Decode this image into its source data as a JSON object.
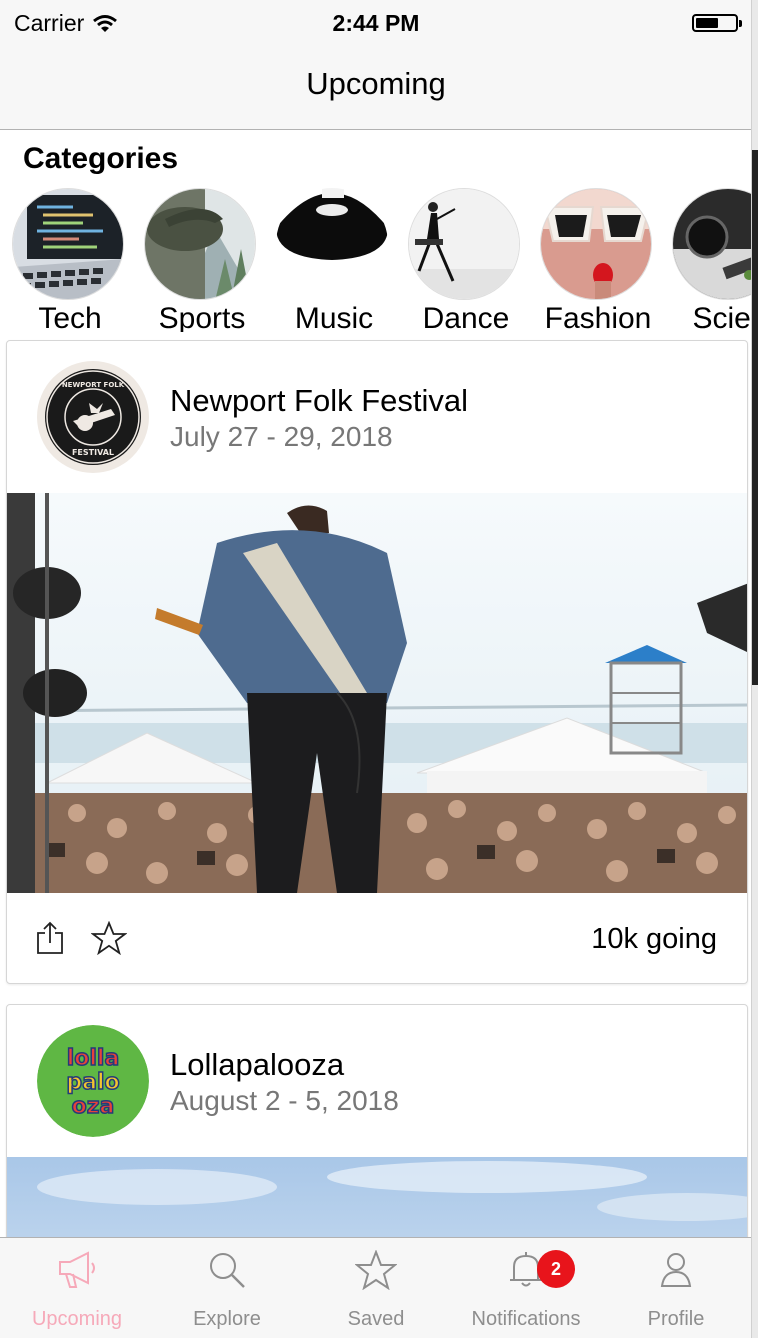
{
  "status_bar": {
    "carrier": "Carrier",
    "time": "2:44 PM"
  },
  "nav": {
    "title": "Upcoming"
  },
  "categories": {
    "heading": "Categories",
    "items": [
      {
        "label": "Tech"
      },
      {
        "label": "Sports"
      },
      {
        "label": "Music"
      },
      {
        "label": "Dance"
      },
      {
        "label": "Fashion"
      },
      {
        "label": "Scien"
      }
    ]
  },
  "events": [
    {
      "title": "Newport Folk Festival",
      "date": "July 27 - 29, 2018",
      "going": "10k going",
      "logo_text": "NEWPORT FOLK FESTIVAL"
    },
    {
      "title": "Lollapalooza",
      "date": "August 2 - 5, 2018",
      "logo_text": "lollapalooza"
    }
  ],
  "tab_bar": {
    "tabs": [
      {
        "label": "Upcoming",
        "icon": "megaphone-icon",
        "active": true
      },
      {
        "label": "Explore",
        "icon": "search-icon"
      },
      {
        "label": "Saved",
        "icon": "star-icon"
      },
      {
        "label": "Notifications",
        "icon": "bell-icon",
        "badge": "2"
      },
      {
        "label": "Profile",
        "icon": "person-icon"
      }
    ]
  },
  "colors": {
    "accent": "#f6a9b9",
    "badge": "#e8141b",
    "bar_bg": "#f7f7f7",
    "secondary_text": "#777777"
  }
}
